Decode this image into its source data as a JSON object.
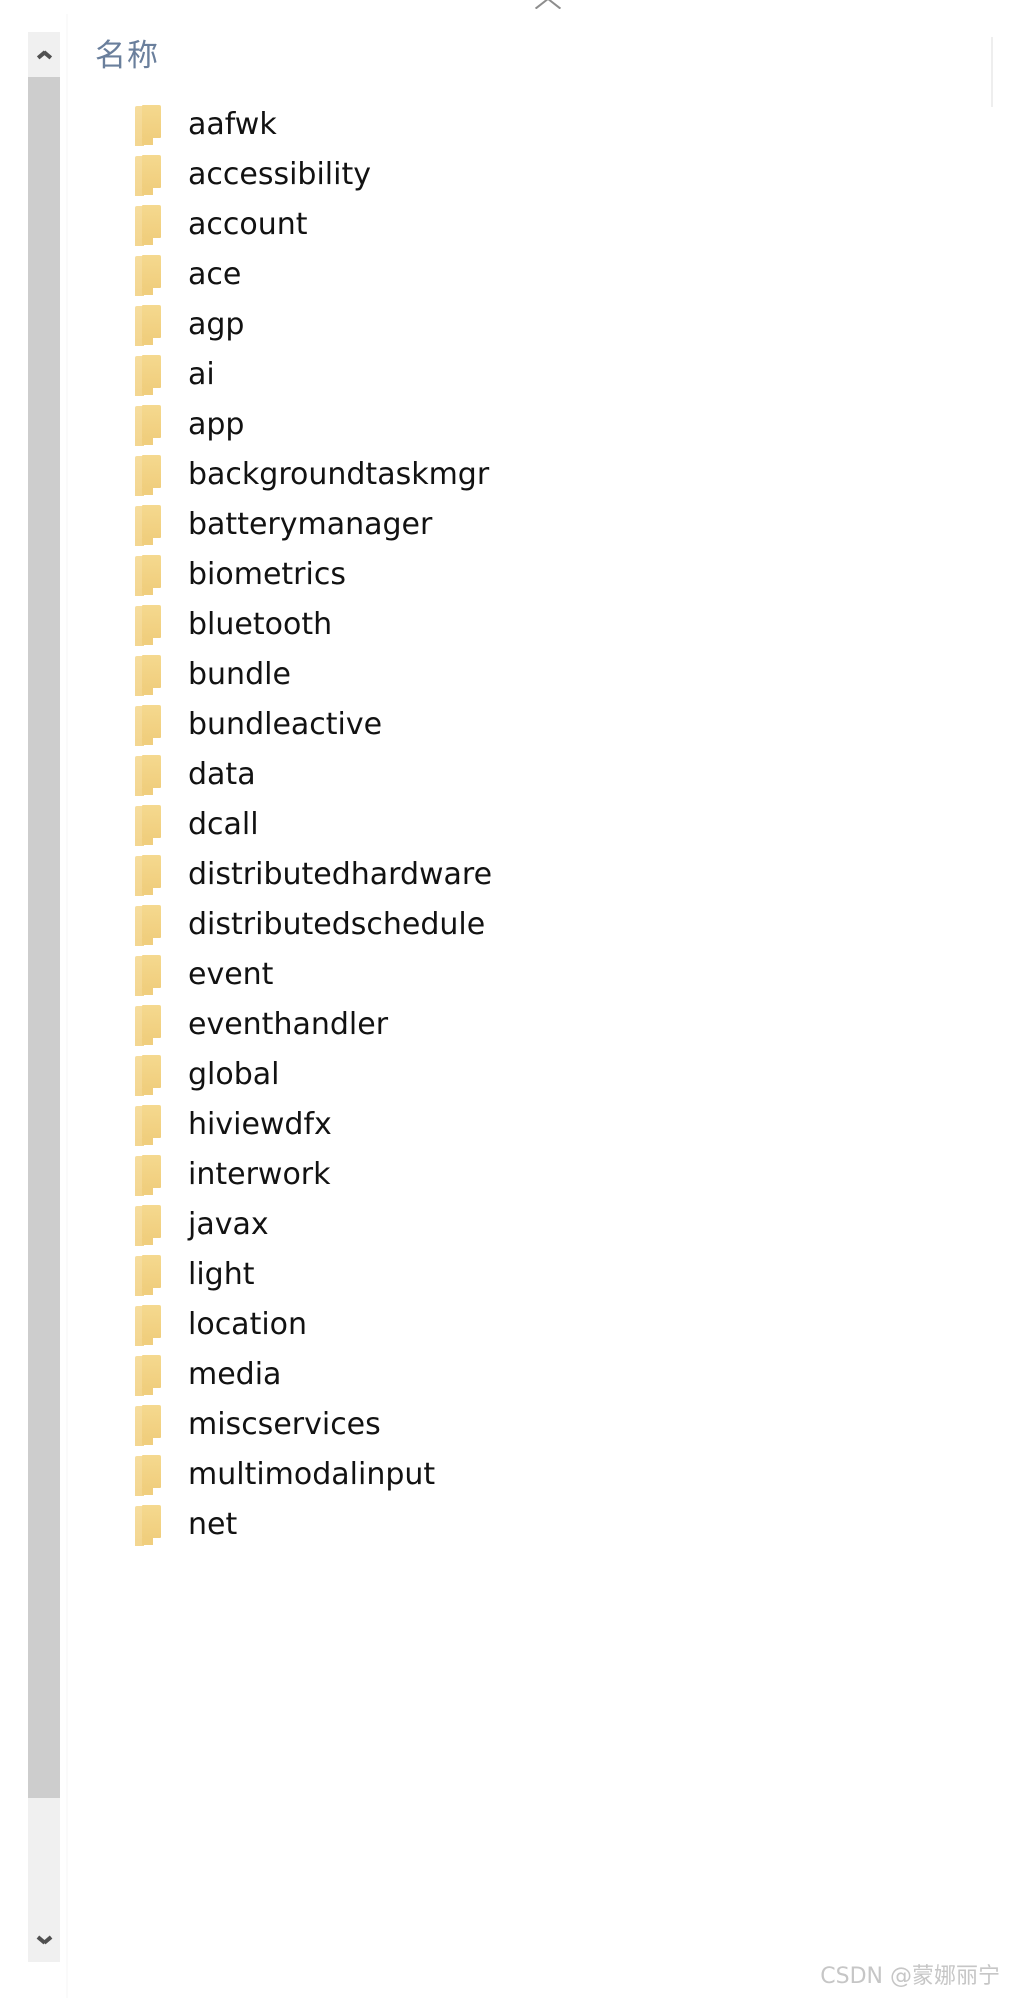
{
  "window": {
    "kind": "file-explorer-details-view"
  },
  "scrollbar": {
    "orientation": "vertical",
    "up_button_icon": "chevron-up-icon",
    "down_button_icon": "chevron-down-icon",
    "thumb_position_percent": 2,
    "thumb_size_percent": 89
  },
  "header": {
    "name_column_label": "名称",
    "sort_indicator_icon": "chevron-up-icon",
    "sort_direction": "ascending",
    "name_color": "#6a7f9c"
  },
  "list": {
    "icon_name": "folder-icon",
    "icon_color": "#f0ce7d",
    "text_color": "#121212",
    "items": [
      {
        "name": "aafwk"
      },
      {
        "name": "accessibility"
      },
      {
        "name": "account"
      },
      {
        "name": "ace"
      },
      {
        "name": "agp"
      },
      {
        "name": "ai"
      },
      {
        "name": "app"
      },
      {
        "name": "backgroundtaskmgr"
      },
      {
        "name": "batterymanager"
      },
      {
        "name": "biometrics"
      },
      {
        "name": "bluetooth"
      },
      {
        "name": "bundle"
      },
      {
        "name": "bundleactive"
      },
      {
        "name": "data"
      },
      {
        "name": "dcall"
      },
      {
        "name": "distributedhardware"
      },
      {
        "name": "distributedschedule"
      },
      {
        "name": "event"
      },
      {
        "name": "eventhandler"
      },
      {
        "name": "global"
      },
      {
        "name": "hiviewdfx"
      },
      {
        "name": "interwork"
      },
      {
        "name": "javax"
      },
      {
        "name": "light"
      },
      {
        "name": "location"
      },
      {
        "name": "media"
      },
      {
        "name": "miscservices"
      },
      {
        "name": "multimodalinput"
      },
      {
        "name": "net"
      }
    ]
  },
  "watermark": {
    "text": "CSDN @蒙娜丽宁",
    "color": "#c6c6c6"
  }
}
